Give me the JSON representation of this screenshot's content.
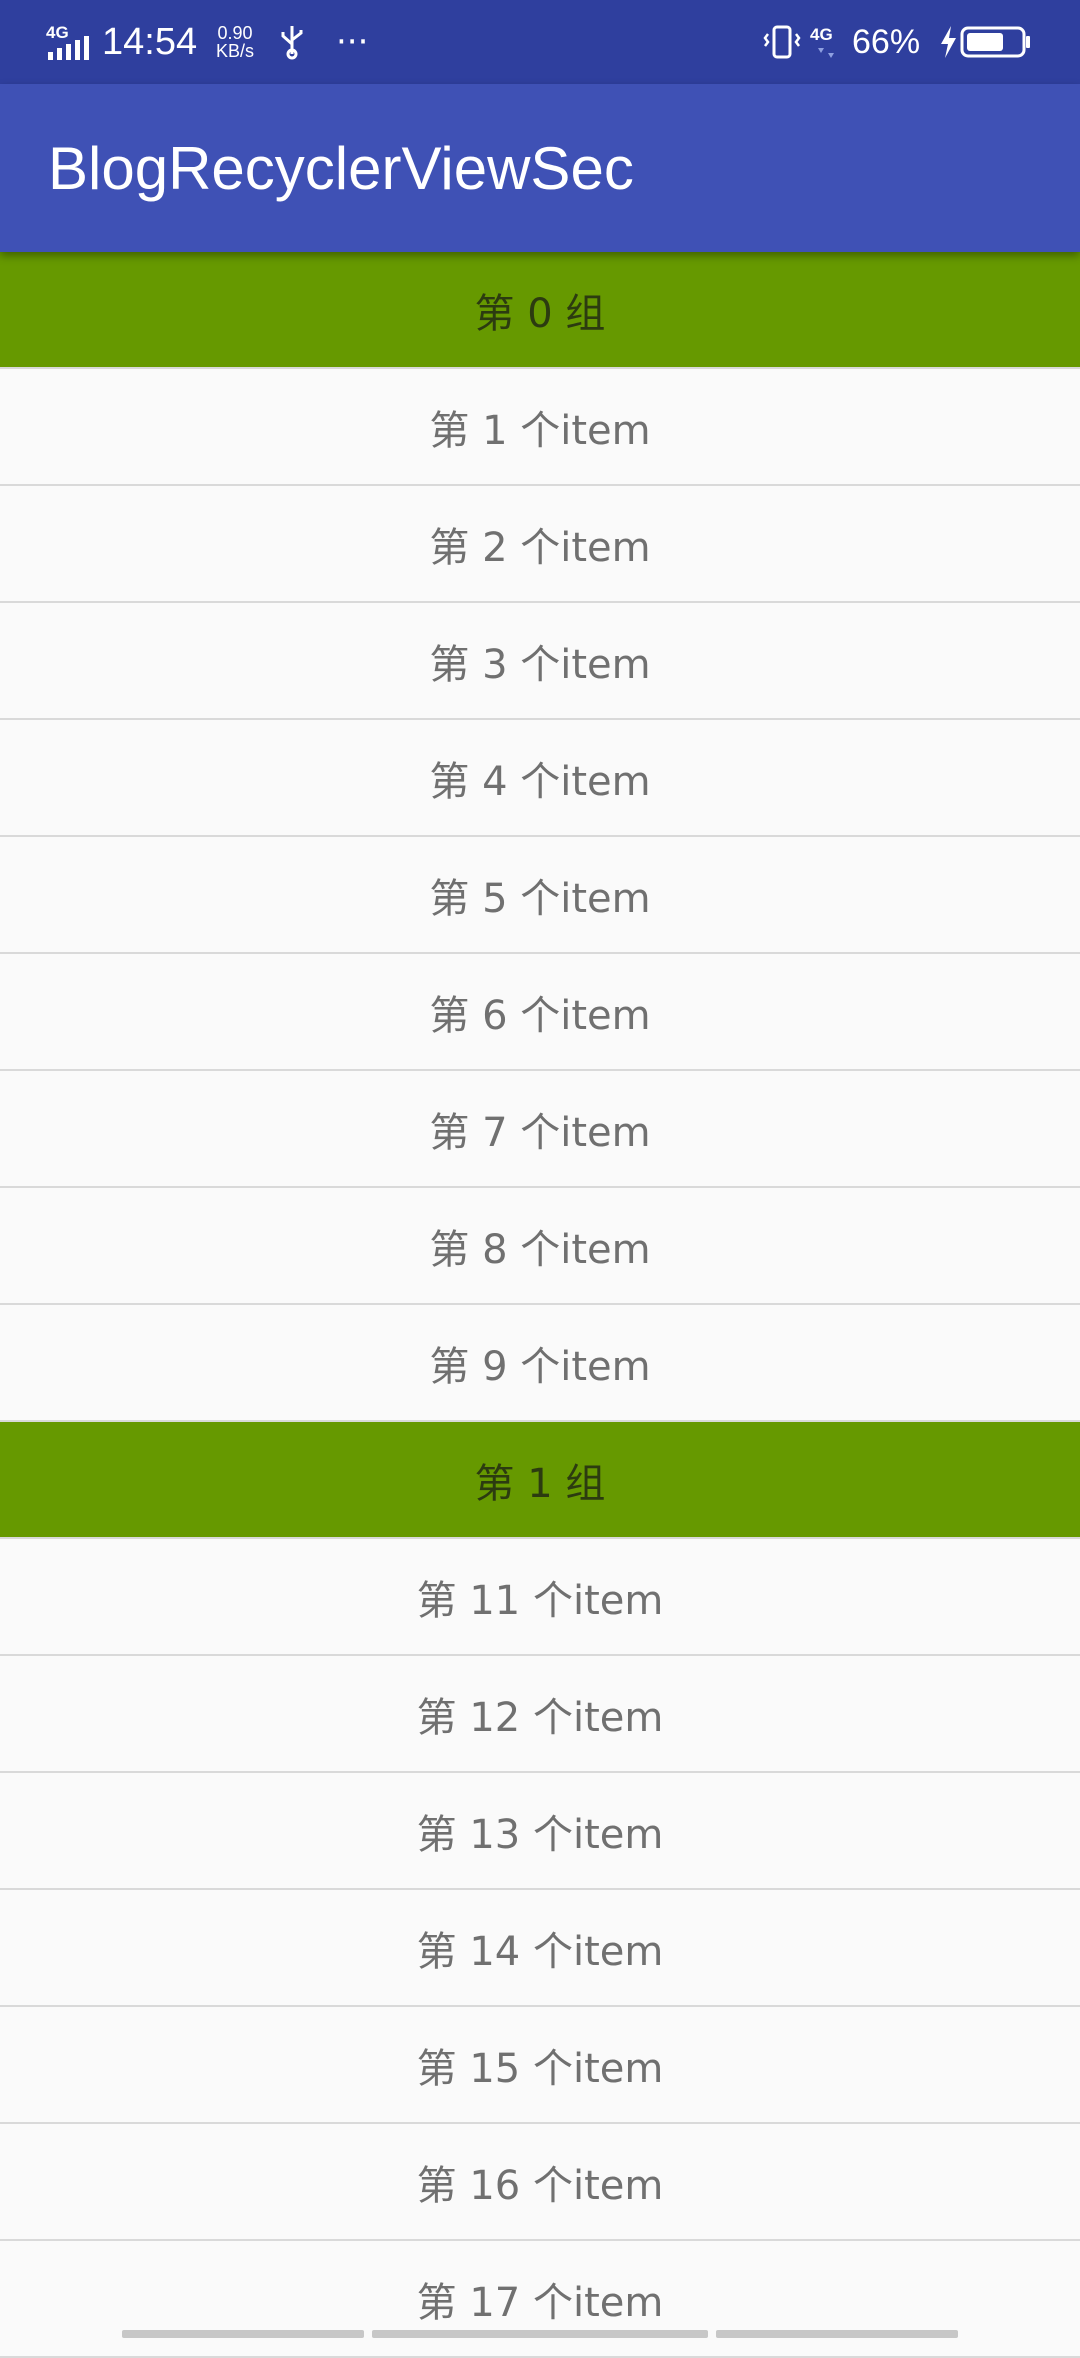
{
  "status_bar": {
    "network": "4G",
    "time": "14:54",
    "speed_value": "0.90",
    "speed_unit": "KB/s",
    "network_right": "4G",
    "battery": "66%"
  },
  "app_bar": {
    "title": "BlogRecyclerViewSec"
  },
  "list": {
    "rows": [
      {
        "type": "header",
        "label": "第 0 组"
      },
      {
        "type": "item",
        "label": "第 1 个item"
      },
      {
        "type": "item",
        "label": "第 2 个item"
      },
      {
        "type": "item",
        "label": "第 3 个item"
      },
      {
        "type": "item",
        "label": "第 4 个item"
      },
      {
        "type": "item",
        "label": "第 5 个item"
      },
      {
        "type": "item",
        "label": "第 6 个item"
      },
      {
        "type": "item",
        "label": "第 7 个item"
      },
      {
        "type": "item",
        "label": "第 8 个item"
      },
      {
        "type": "item",
        "label": "第 9 个item"
      },
      {
        "type": "header",
        "label": "第 1 组"
      },
      {
        "type": "item",
        "label": "第 11 个item"
      },
      {
        "type": "item",
        "label": "第 12 个item"
      },
      {
        "type": "item",
        "label": "第 13 个item"
      },
      {
        "type": "item",
        "label": "第 14 个item"
      },
      {
        "type": "item",
        "label": "第 15 个item"
      },
      {
        "type": "item",
        "label": "第 16 个item"
      },
      {
        "type": "item",
        "label": "第 17 个item"
      }
    ]
  },
  "colors": {
    "status_bar": "#2f3f9e",
    "app_bar": "#3f51b5",
    "section_header": "#669900",
    "item_background": "#fafafa"
  }
}
